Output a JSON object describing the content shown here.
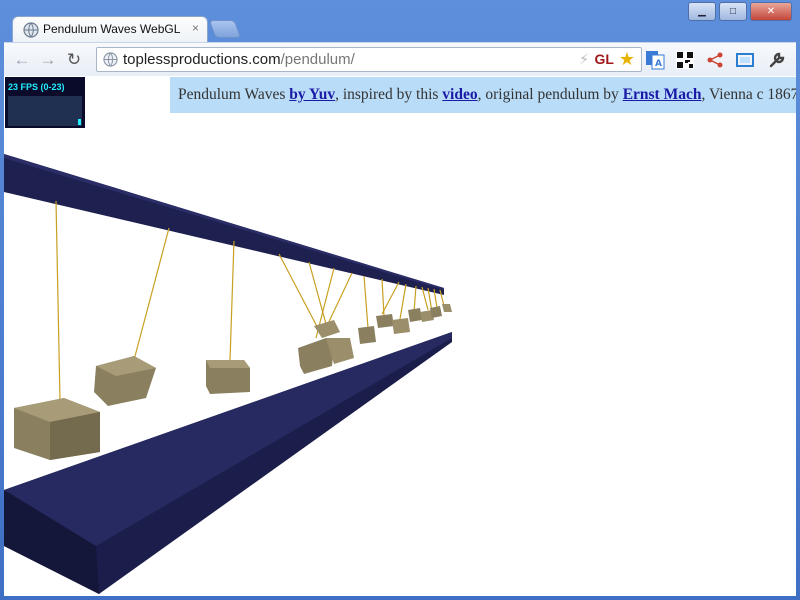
{
  "browser": {
    "tab_title": "Pendulum Waves WebGL",
    "tab_close": "×",
    "url_host": "toplessproductions.com",
    "url_path": "/pendulum/",
    "gl_badge": "GL",
    "icons": [
      "globe-icon",
      "back-icon",
      "forward-icon",
      "reload-icon",
      "bolt-icon",
      "star-icon",
      "translate-icon",
      "qr-icon",
      "share-icon",
      "screenshot-icon",
      "wrench-icon"
    ]
  },
  "window_controls": {
    "minimize": "▁",
    "maximize": "□",
    "close": "✕"
  },
  "fps": {
    "label": "23 FPS (0-23)"
  },
  "banner": {
    "part1": "Pendulum Waves ",
    "link1": "by Yuv",
    "part2": ", inspired by this ",
    "link2": "video",
    "part3": ", original pendulum by ",
    "link3": "Ernst Mach",
    "part4": ", Vienna c 1867."
  },
  "colors": {
    "beam": "#1e2050",
    "block": "#8a8060",
    "string": "#c8a020",
    "banner_bg": "#b9dcf8"
  }
}
